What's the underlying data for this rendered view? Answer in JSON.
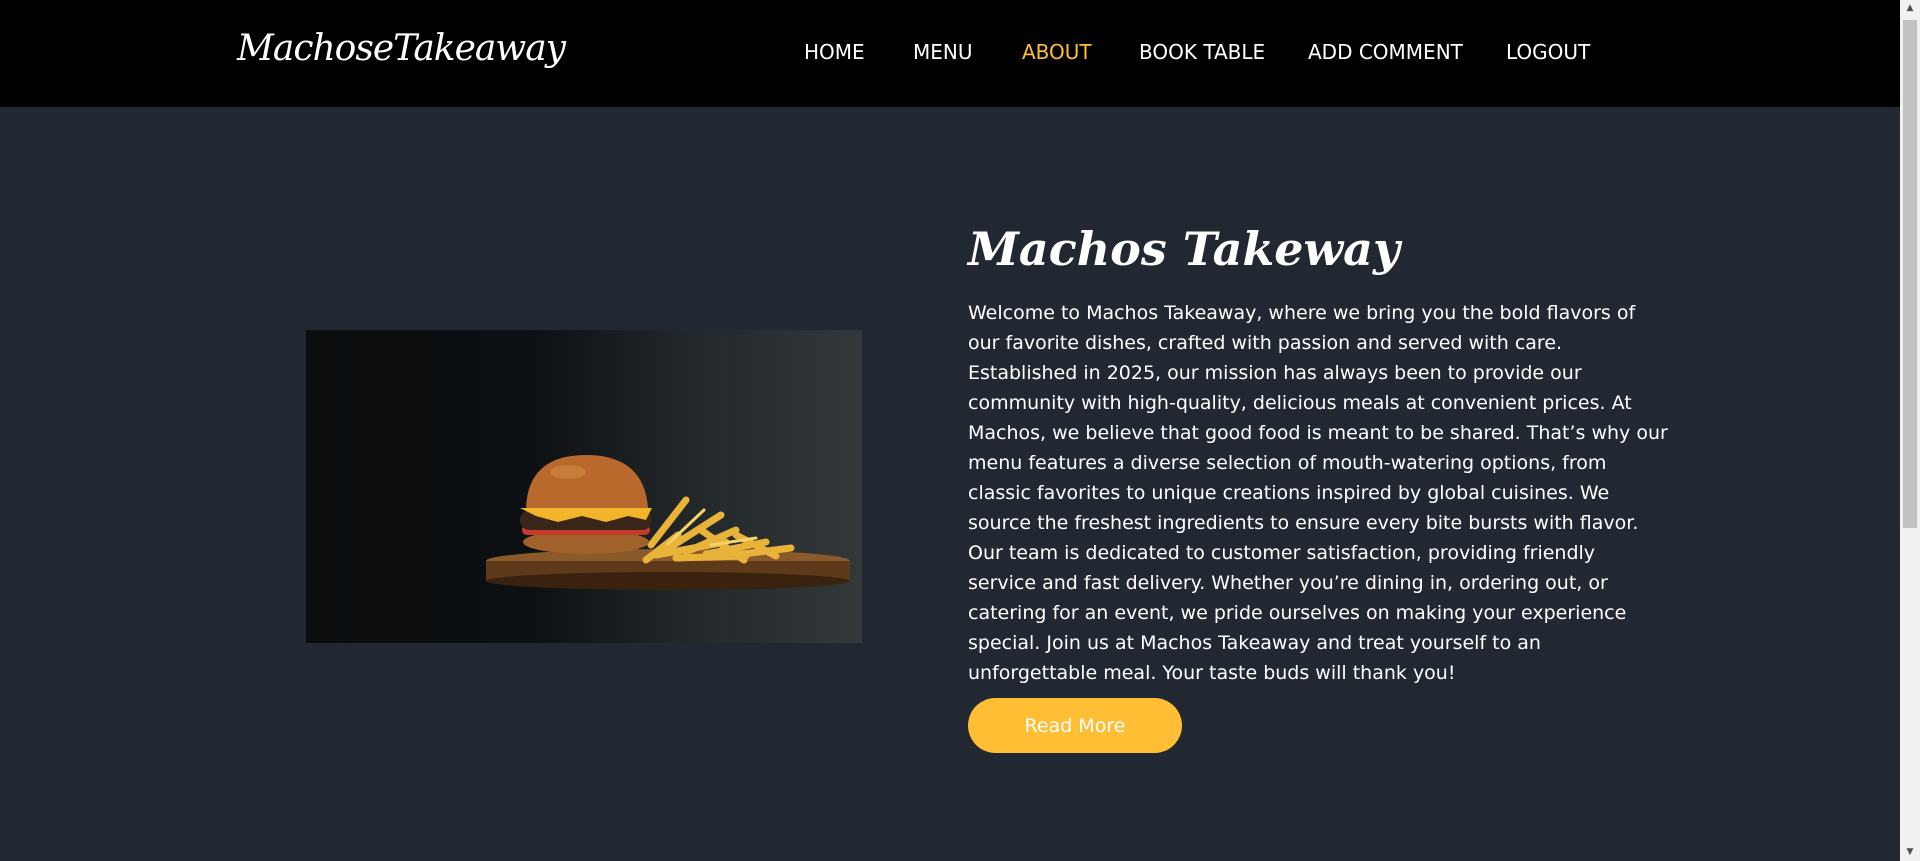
{
  "header": {
    "brand": "MachoseTakeaway",
    "nav": [
      {
        "label": "HOME",
        "active": false
      },
      {
        "label": "MENU",
        "active": false
      },
      {
        "label": "ABOUT",
        "active": true
      },
      {
        "label": "BOOK TABLE",
        "active": false
      },
      {
        "label": "ADD COMMENT",
        "active": false
      },
      {
        "label": "LOGOUT",
        "active": false
      }
    ]
  },
  "about": {
    "title": "Machos Takeway",
    "paragraph": "Welcome to Machos Takeaway, where we bring you the bold flavors of our favorite dishes, crafted with passion and served with care. Established in 2025, our mission has always been to provide our community with high-quality, delicious meals at convenient prices. At Machos, we believe that good food is meant to be shared. That’s why our menu features a diverse selection of mouth-watering options, from classic favorites to unique creations inspired by global cuisines. We source the freshest ingredients to ensure every bite bursts with flavor. Our team is dedicated to customer satisfaction, providing friendly service and fast delivery. Whether you’re dining in, ordering out, or catering for an event, we pride ourselves on making your experience special. Join us at Machos Takeaway and treat yourself to an unforgettable meal. Your taste buds will thank you!",
    "button": "Read More"
  },
  "colors": {
    "header_bg": "#000000",
    "page_bg": "#222831",
    "accent": "#ffbe33",
    "text": "#ffffff"
  },
  "icons": {
    "scroll_up": "scroll-up-arrow-icon",
    "scroll_down": "scroll-down-arrow-icon"
  }
}
